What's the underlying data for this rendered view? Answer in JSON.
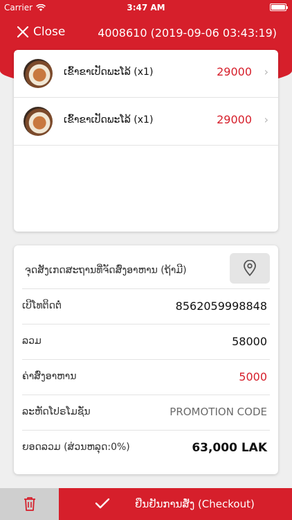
{
  "status_bar": {
    "carrier": "Carrier",
    "time": "3:47 AM"
  },
  "header": {
    "close_label": "Close",
    "order_title": "4008610 (2019-09-06 03:43:19)"
  },
  "items": [
    {
      "name": "ເຂົ້າຂາເປັດພະໂລ້ (x1)",
      "price": "29000"
    },
    {
      "name": "ເຂົ້າຂາເປັດພະໂລ້ (x1)",
      "price": "29000"
    }
  ],
  "details": {
    "location_label": "ຈຸດສັງເກດສະຖານທີ່ຈັດສົ່ງອາຫານ (ຖ້າມີ)",
    "phone_label": "ເບີໂທຕິດຕໍ່",
    "phone_value": "8562059998848",
    "sum_label": "ລວມ",
    "sum_value": "58000",
    "delivery_label": "ຄ່າສົ່ງອາຫານ",
    "delivery_value": "5000",
    "promo_label": "ລະຫັດໂປຣໂມຊັ່ນ",
    "promo_placeholder": "PROMOTION CODE",
    "total_label": "ຍອດລວມ (ສ່ວນຫລຸດ:0%)",
    "total_value": "63,000 LAK"
  },
  "bottom": {
    "checkout_label": "ຢືນຢັນການສັ່ງ (Checkout)"
  },
  "colors": {
    "brand_red": "#d61f2b",
    "price_red": "#d61f2b"
  },
  "icons": [
    "wifi-icon",
    "battery-icon",
    "close-icon",
    "chevron-right-icon",
    "location-pin-icon",
    "trash-icon",
    "checkmark-icon"
  ]
}
